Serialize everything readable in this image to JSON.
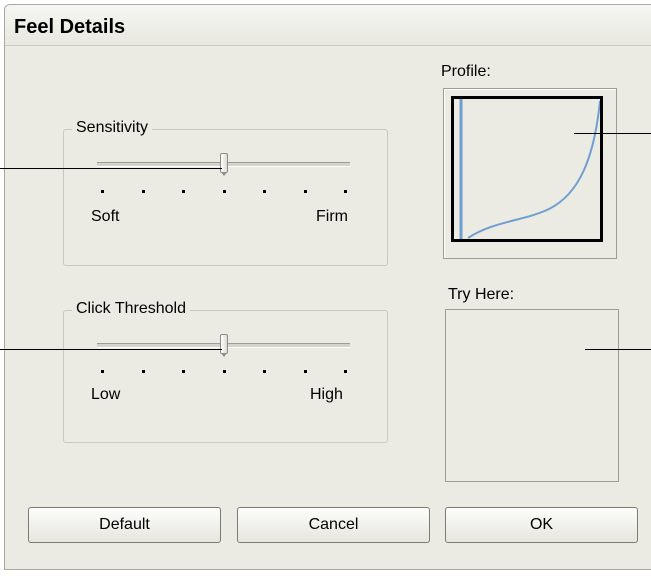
{
  "dialog": {
    "title": "Feel Details"
  },
  "sensitivity": {
    "legend": "Sensitivity",
    "min_label": "Soft",
    "max_label": "Firm",
    "value_fraction": 0.5,
    "tick_count": 7
  },
  "click_threshold": {
    "legend": "Click Threshold",
    "min_label": "Low",
    "max_label": "High",
    "value_fraction": 0.5,
    "tick_count": 7
  },
  "profile": {
    "label": "Profile:",
    "curve_color": "#6f9fd1"
  },
  "try_here": {
    "label": "Try Here:"
  },
  "buttons": {
    "default": "Default",
    "cancel": "Cancel",
    "ok": "OK"
  }
}
